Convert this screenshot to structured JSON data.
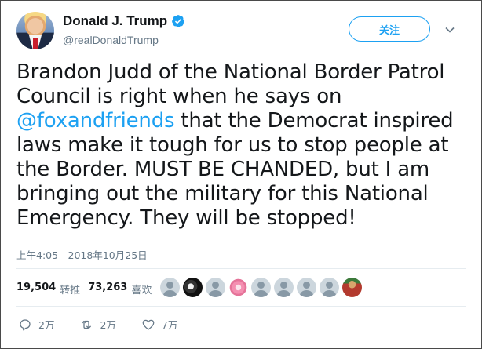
{
  "user": {
    "name": "Donald J. Trump",
    "handle": "@realDonaldTrump",
    "follow_label": "关注"
  },
  "tweet": {
    "text_before": "Brandon Judd of the National Border Patrol Council is right when he says on ",
    "mention": "@foxandfriends",
    "text_after": " that the Democrat inspired laws make it tough for us to stop people at the Border. MUST BE CHANDED, but I am bringing out the military for this National Emergency. They will be stopped!",
    "timestamp": "上午4:05 - 2018年10月25日"
  },
  "stats": {
    "retweets_count": "19,504",
    "retweets_label": "转推",
    "likes_count": "73,263",
    "likes_label": "喜欢"
  },
  "actions": {
    "reply_count": "2万",
    "retweet_count": "2万",
    "like_count": "7万"
  },
  "colors": {
    "accent": "#1da1f2",
    "text": "#14171a",
    "muted": "#657786"
  }
}
